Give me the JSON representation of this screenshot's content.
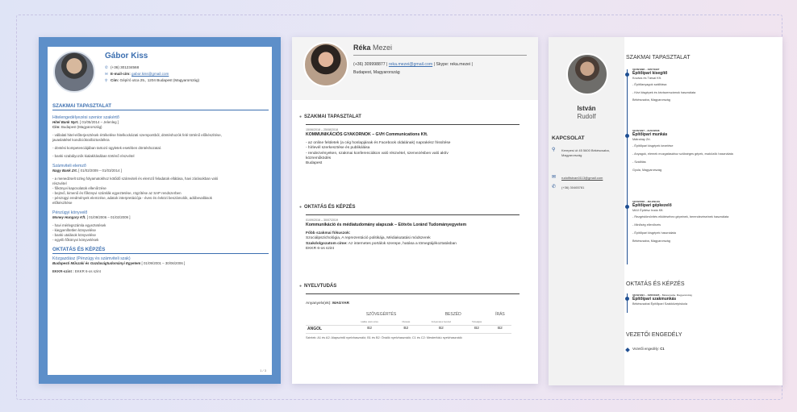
{
  "cv1": {
    "name": "Gábor Kiss",
    "phone": "(+36) 301234568",
    "email_label": "E-mail-cím:",
    "email": "gabor.kiss@gmail.com",
    "address_label": "Cím:",
    "address": "Gépíró utca 25., 1204 Budapest (Magyarország)",
    "experience_heading": "SZAKMAI TAPASZTALAT",
    "jobs": [
      {
        "title": "Hitelengedélyezési szenior szakértő",
        "company": "Hitel Bank Nyrt.",
        "dates": "[ 01/05/2014 – Jelenleg ]",
        "city_label": "Cím:",
        "city": "Budapest (Magyarország)",
        "lines": [
          "- vállalati hitel-előterjesztések értékelése hitelkockázati szempontból, döntéshozók felé történő előkészítése,",
          "javaslattétel kondíciókra/biztosítékra",
          "- döntési kompetenciájában tartozó ügyletek esetében döntéshozatal.",
          "- banki szabályozók kialakításában történő részvétel"
        ]
      },
      {
        "title": "Számviteli elemző",
        "company": "Nagy Bank Zrt.",
        "dates": "[ 01/02/2009 – 01/03/2014 ]",
        "lines": [
          "- a menedzselt üzleg folyamatokhoz kötődő számviteli és elemző feladatok ellátása, havi zárásokban való",
          "részvétel",
          "- főkönyvi kapcsolatok ellenőrzése",
          "- bejövő, kimenő és főkönyvi számlák egyeztetése, rögzítése az SAP rendszerben",
          "- pénzügyi eredmények elemzése, adatok interpretációja - éves és évközi beszámolók, adóbevallások",
          "előkészítése"
        ]
      },
      {
        "title": "Pénzügyi könyvelő",
        "company": "Money Hungary Kft.",
        "dates": "[ 01/09/2006 – 01/02/2009 ]",
        "lines": [
          "- havi mérlegszámla egyeztetések",
          "- kiegyenlítetlen könyvelése",
          "- banki utalások könyvelése",
          "- egyéb főkönyvi könyvelések"
        ]
      }
    ],
    "education_heading": "OKTATÁS ÉS KÉPZÉS",
    "edu_title": "Közgazdász (Pénzügy és számviteli szak)",
    "edu_school": "Budapesti Műszaki és Gazdaságtudományi Egyetem",
    "edu_dates": "[ 01/09/2001 – 30/06/2006 ]",
    "edu_extra_label": "EKKR-szint :",
    "edu_extra": "EKKR 6-os szint",
    "page_no": "1 / 3"
  },
  "cv2": {
    "first_name": "Réka",
    "last_name": "Mezei",
    "contact_line_pre": "(+36) 309998877 |",
    "email": "reka.mezei@gmail.com",
    "contact_line_post": "| Skype: reka.mezei |",
    "city": "Budapest, Magyarország",
    "exp_heading": "SZAKMAI TAPASZTALAT",
    "exp_dates": "15/06/2018 – 25/08/2018",
    "exp_title": "KOMMUNIKÁCIÓS GYAKORNOK – GVH Communications Kft.",
    "exp_lines": [
      "- az online felületek (a cég honlapjának és Facebook oldalának) naprakész frissítése",
      "- hírlevél szerkesztése és publikálása",
      "- rendezvényeken, szakmai konferenciákon való részvétel, szervezésben való aktív",
      "közreműködés",
      "Budapest"
    ],
    "edu_heading": "OKTATÁS ÉS KÉPZÉS",
    "edu_dates": "01/09/2016 – 30/07/2019",
    "edu_title": "Kommunikáció és médiatudomány alapszak – Eötvös Loránd Tudományegyetem",
    "edu_focus_label": "Főbb szakmai fókuszok:",
    "edu_focus": "Szociálpszichológia, A reprezentáció politikája, Médiakutatási módszerek",
    "edu_thesis_label": "Szakdolgozatom címe:",
    "edu_thesis": "Az internetes portálok szerepe, hatása a tömegtájékoztatásban",
    "edu_level": "EKKR 6-os szint",
    "lang_heading": "NYELVTUDÁS",
    "mother_label": "Anyanyelv(ek):",
    "mother": "MAGYAR",
    "col_understanding": "SZÖVEGÉRTÉS",
    "col_speaking": "BESZÉD",
    "col_writing": "ÍRÁS",
    "sub_listening": "Hallás utáni értés",
    "sub_reading": "Olvasás",
    "sub_interaction": "Folyamatos beszéd",
    "sub_production": "Társalgás",
    "lang_name": "ANGOL",
    "levels": [
      "B2",
      "B2",
      "B2",
      "B2",
      "B2"
    ],
    "scale_note": "Szintek: A1 és A2: Alapszintű nyelvhasználó; B1 és B2: Önálló nyelvhasználó; C1 és C2: Mesterfokú nyelvhasználó"
  },
  "cv3": {
    "first_name": "István",
    "last_name": "Rudolf",
    "contact_heading": "KAPCSOLAT",
    "address": "Kerepesi út 45 5600 Békéscsaba, Magyarország",
    "email": "rudolfistvan0113@gmail.com",
    "phone": "(+36) 30465781",
    "exp_heading": "SZAKMAI TAPASZTALAT",
    "jobs": [
      {
        "dates": "01/08/1998 – 10/07/1997",
        "title": "Építőipari kisegítő",
        "company": "Kovács és Társai Kft.",
        "items": [
          "- Építőanyagok szállítása",
          "- Kézi kisgépek és kéziszerszámok használata"
        ],
        "city": "Békéscsaba, Magyarország"
      },
      {
        "dates": "01/06/1997 – 21/02/2008",
        "title": "Építőipari munkás",
        "company": "Mátraháy Zrt.",
        "items": [
          "- Építőipari kisgépek kezelése",
          "- Anyagok, elemek mozgatásához szükséges gépek, eszközök használata",
          "- Szállítás"
        ],
        "city": "Gyula, Magyarország"
      },
      {
        "dates": "10/03/2008 – JELENLEG",
        "title": "Építőipari gépkezelő",
        "company": "MAX Építész Iroda Kft.",
        "items": [
          "- Rezgéstömörítés elkötéséhez gépeinek, berendezéseinek használata",
          "- Minőség ellenőrzés",
          "- Építőipari kisgépek használata"
        ],
        "city": "Békéscsaba, Magyarország"
      }
    ],
    "edu_heading": "OKTATÁS ÉS KÉPZÉS",
    "edu_dates": "04/09/1991 – 10/06/1995",
    "edu_city": "– Békéscsaba, Magyarország",
    "edu_title": "Építőipari szakmunkás",
    "edu_school": "Békéscsabai Építőipari Szakközépiskola",
    "license_heading": "VEZETŐI ENGEDÉLY",
    "license_label": "Vezetői engedély:",
    "license_value": "C1"
  }
}
